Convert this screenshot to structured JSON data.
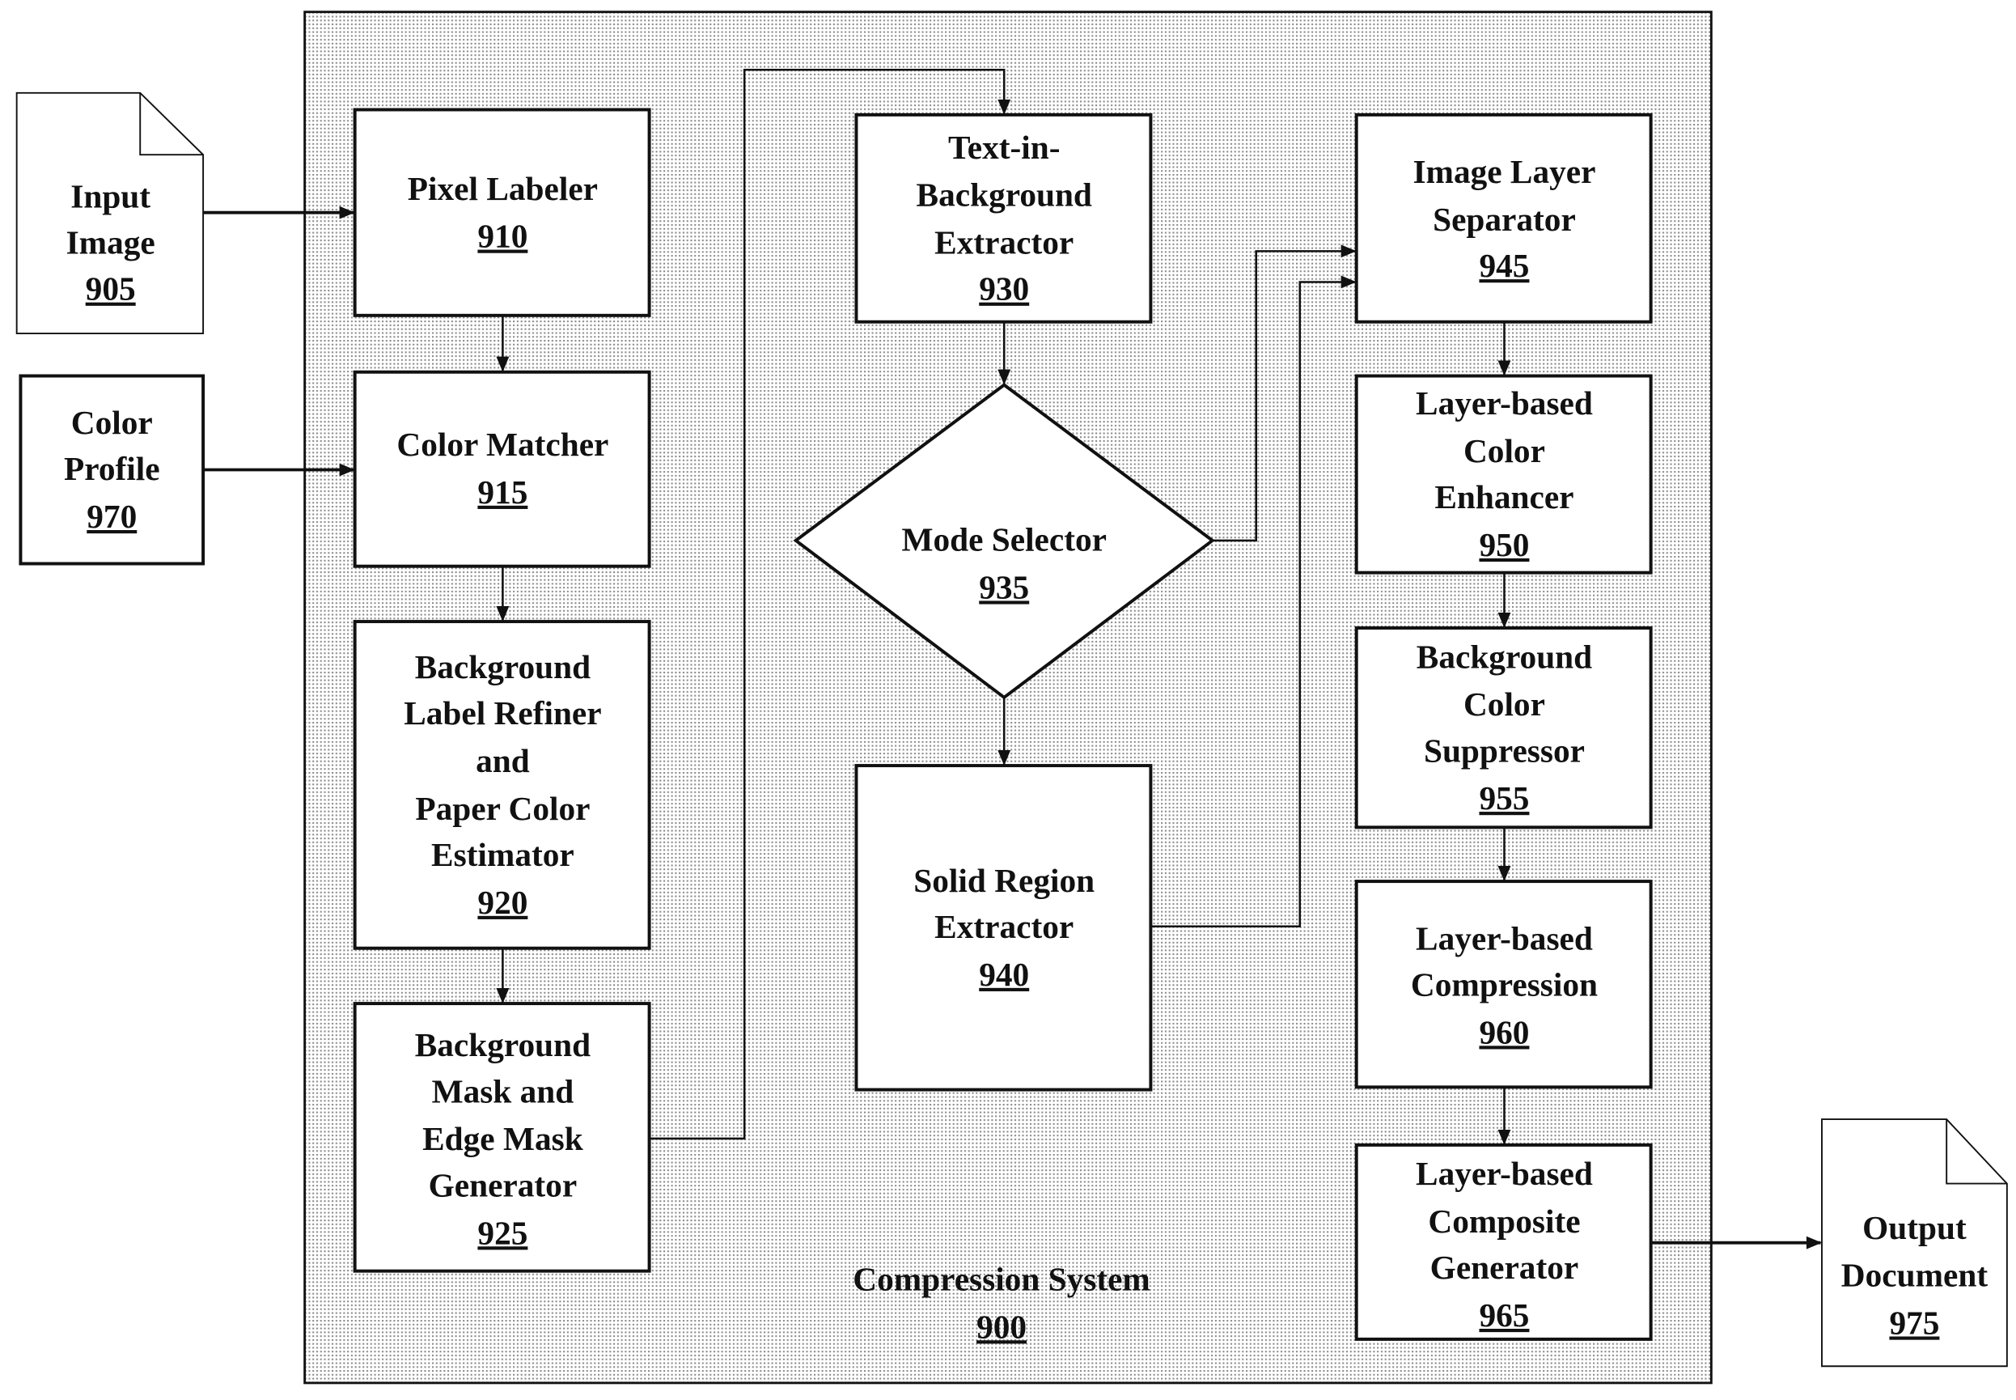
{
  "system": {
    "label": "Compression System",
    "number": "900"
  },
  "external": {
    "input_image": {
      "lines": [
        "Input",
        "Image"
      ],
      "number": "905"
    },
    "color_profile": {
      "lines": [
        "Color",
        "Profile"
      ],
      "number": "970"
    },
    "output_document": {
      "lines": [
        "Output",
        "Document"
      ],
      "number": "975"
    }
  },
  "blocks": {
    "pixel_labeler": {
      "lines": [
        "Pixel Labeler"
      ],
      "number": "910"
    },
    "color_matcher": {
      "lines": [
        "Color Matcher"
      ],
      "number": "915"
    },
    "bg_label_refiner": {
      "lines": [
        "Background",
        "Label Refiner",
        "and",
        "Paper Color",
        "Estimator"
      ],
      "number": "920"
    },
    "bg_mask_generator": {
      "lines": [
        "Background",
        "Mask and",
        "Edge Mask",
        "Generator"
      ],
      "number": "925"
    },
    "text_in_bg_extractor": {
      "lines": [
        "Text-in-",
        "Background",
        "Extractor"
      ],
      "number": "930"
    },
    "mode_selector": {
      "lines": [
        "Mode Selector"
      ],
      "number": "935"
    },
    "solid_region_extractor": {
      "lines": [
        "Solid Region",
        "Extractor"
      ],
      "number": "940"
    },
    "image_layer_separator": {
      "lines": [
        "Image Layer",
        "Separator"
      ],
      "number": "945"
    },
    "color_enhancer": {
      "lines": [
        "Layer-based",
        "Color",
        "Enhancer"
      ],
      "number": "950"
    },
    "bg_color_suppressor": {
      "lines": [
        "Background",
        "Color",
        "Suppressor"
      ],
      "number": "955"
    },
    "layer_compression": {
      "lines": [
        "Layer-based",
        "Compression"
      ],
      "number": "960"
    },
    "composite_generator": {
      "lines": [
        "Layer-based",
        "Composite",
        "Generator"
      ],
      "number": "965"
    }
  }
}
